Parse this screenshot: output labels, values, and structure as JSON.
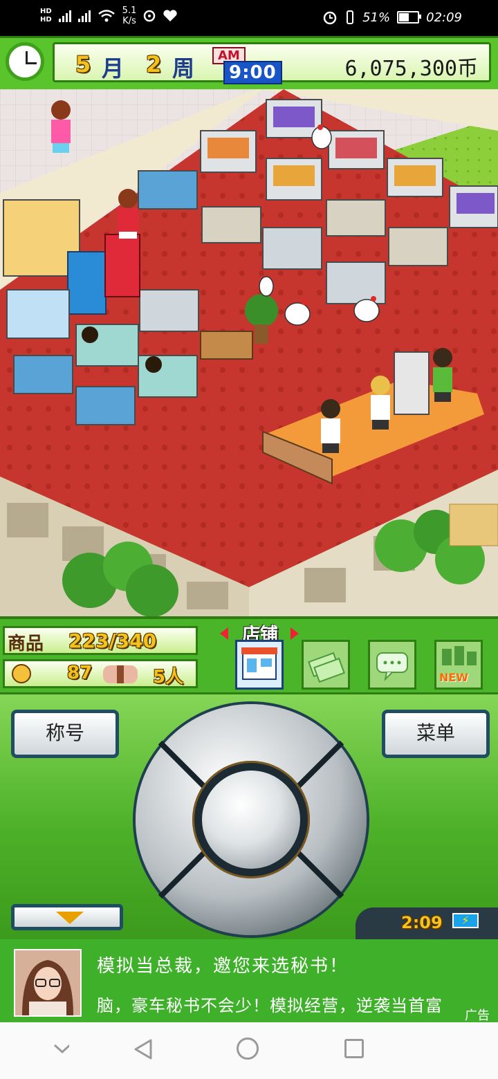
{
  "status_bar": {
    "network_speed": "5.1",
    "network_speed_unit": "K/s",
    "battery_percent": "51%",
    "time": "02:09"
  },
  "hud": {
    "month_number": "5",
    "month_label": "月",
    "week_number": "2",
    "week_label": "周",
    "ampm": "AM",
    "time": "9:00",
    "money": "6,075,300币"
  },
  "stats": {
    "goods_label": "商品",
    "goods_value": "223/340",
    "rating_value": "87",
    "people_value": "5人"
  },
  "tabs": {
    "store_label": "店铺",
    "new_badge": "NEW"
  },
  "controller": {
    "title_button": "称号",
    "menu_button": "菜单",
    "clock_time": "2:09"
  },
  "ad": {
    "line1": "模拟当总裁，邀您来选秘书！",
    "line2": "脑，豪车秘书不会少！模拟经营，逆袭当首富",
    "tag": "广告"
  },
  "colors": {
    "hud_green": "#5ac42c",
    "floor_red": "#c6362e",
    "ad_green": "#3eb02a"
  }
}
